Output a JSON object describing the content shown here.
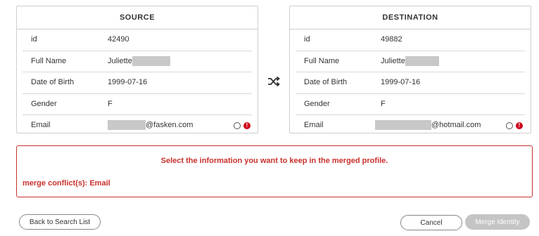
{
  "source": {
    "title": "SOURCE",
    "fields": [
      {
        "label": "id",
        "value": "42490"
      },
      {
        "label": "Full Name",
        "value": "Juliette"
      },
      {
        "label": "Date of Birth",
        "value": "1999-07-16"
      },
      {
        "label": "Gender",
        "value": "F"
      },
      {
        "label": "Email",
        "value": "@fasken.com"
      }
    ]
  },
  "destination": {
    "title": "DESTINATION",
    "fields": [
      {
        "label": "id",
        "value": "49882"
      },
      {
        "label": "Full Name",
        "value": "Juliette"
      },
      {
        "label": "Date of Birth",
        "value": "1999-07-16"
      },
      {
        "label": "Gender",
        "value": "F"
      },
      {
        "label": "Email",
        "value": "@hotmail.com"
      }
    ]
  },
  "icons": {
    "swap": "shuffle-icon",
    "warning": "warning-icon",
    "warning_glyph": "!"
  },
  "conflict": {
    "message": "Select the information you want to keep in the merged profile.",
    "list": "merge conflict(s): Email",
    "color": "#c9302c"
  },
  "buttons": {
    "back": "Back to Search List",
    "cancel": "Cancel",
    "merge": "Merge Identity"
  }
}
